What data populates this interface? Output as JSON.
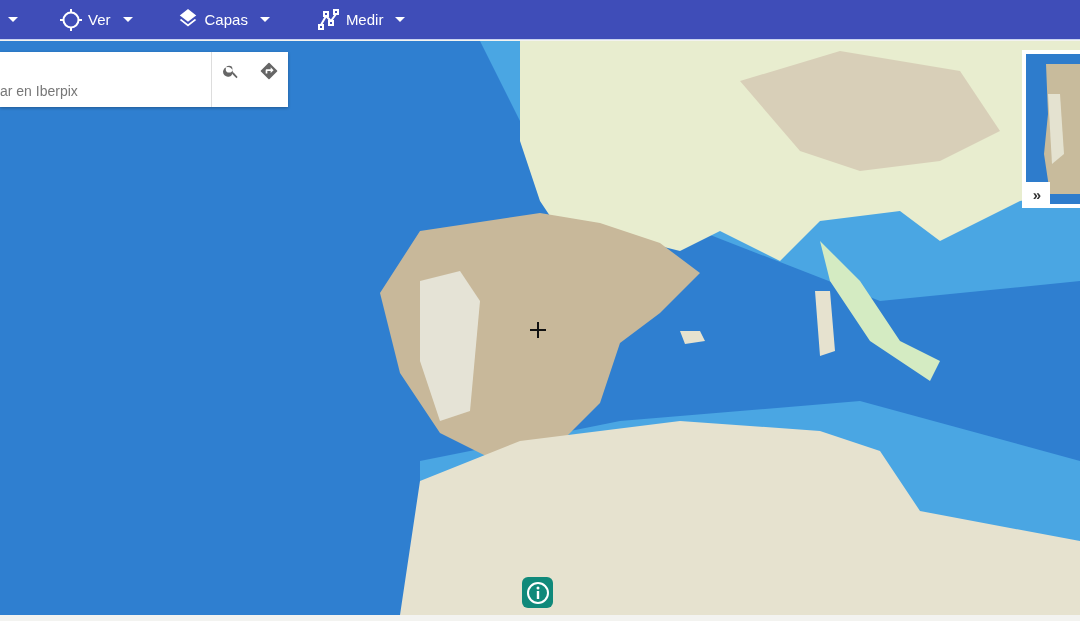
{
  "toolbar": {
    "menus": [
      {
        "label": "Ver"
      },
      {
        "label": "Capas"
      },
      {
        "label": "Medir"
      }
    ]
  },
  "search": {
    "placeholder": "ar en Iberpix"
  },
  "overview_map": {
    "toggle": "»"
  }
}
